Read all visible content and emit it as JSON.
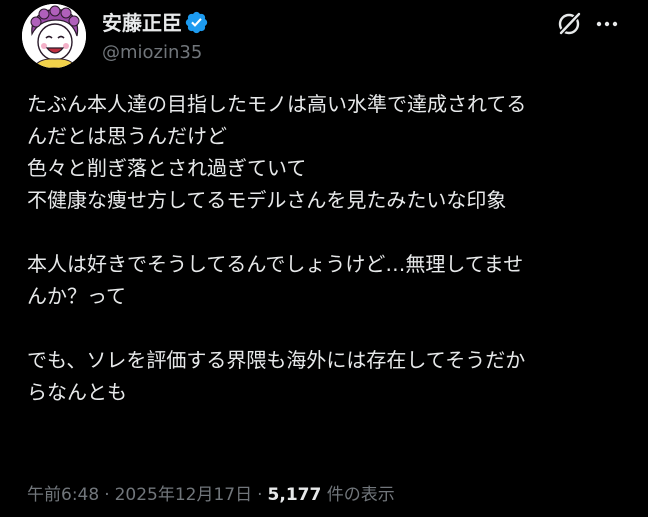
{
  "author": {
    "display_name": "安藤正臣",
    "handle": "@miozin35",
    "verified": true,
    "avatar_icon": "caricature-avatar"
  },
  "actions": {
    "grok_icon": "grok-icon",
    "more_icon": "more-dots-icon"
  },
  "tweet": {
    "paragraphs": [
      [
        "たぶん本人達の目指したモノは高い水準で達成されてる",
        "んだとは思うんだけど",
        "色々と削ぎ落とされ過ぎていて",
        "不健康な痩せ方してるモデルさんを見たみたいな印象"
      ],
      [
        "本人は好きでそうしてるんでしょうけど…無理してませ",
        "んか？って"
      ],
      [
        "でも、ソレを評価する界隈も海外には存在してそうだか",
        "らなんとも"
      ]
    ]
  },
  "meta": {
    "time": "午前6:48",
    "date": "2025年12月17日",
    "separator": "·",
    "views_count": "5,177",
    "views_label": "件の表示"
  },
  "colors": {
    "background": "#000000",
    "text_primary": "#e7e9ea",
    "text_secondary": "#71767b",
    "verified_blue": "#1d9bf0"
  }
}
